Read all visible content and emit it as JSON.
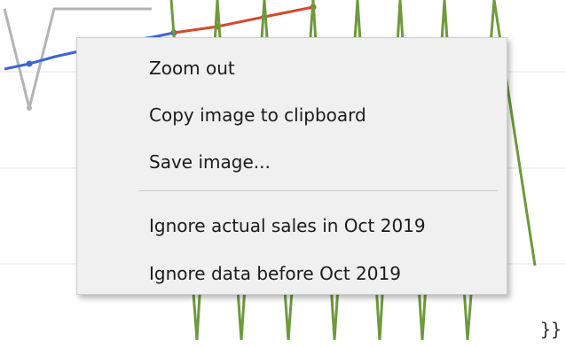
{
  "context_menu": {
    "items": [
      {
        "label": "Zoom out"
      },
      {
        "label": "Copy image to clipboard"
      },
      {
        "label": "Save image..."
      },
      {
        "label": "Ignore actual sales in Oct 2019"
      },
      {
        "label": "Ignore data before Oct 2019"
      }
    ]
  },
  "trailing_text": "}}",
  "colors": {
    "series_gray": "#b4b4b4",
    "series_blue": "#3a66d6",
    "series_red": "#d9472b",
    "series_green": "#6e9a3c",
    "gridline": "#e3e3e3",
    "menu_background": "#f0f0f0"
  }
}
